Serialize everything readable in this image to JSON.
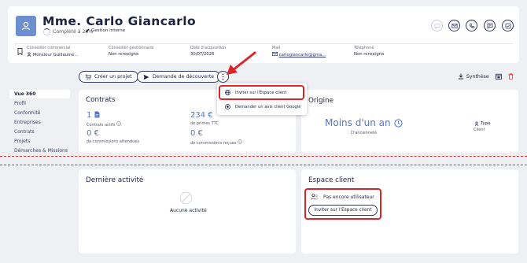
{
  "header": {
    "client_name": "Mme. Carlo Giancarlo",
    "completion": "Complété à 20%",
    "gestion_label": "Gestion interne",
    "fields": [
      {
        "label": "Conseiller commercial",
        "value": "Monsieur Guillaume..."
      },
      {
        "label": "Conseiller gestionnaire",
        "value": "Non renseigné"
      },
      {
        "label": "Date d'acquisition",
        "value": "30/07/2026"
      },
      {
        "label": "Mail",
        "value": "carlogiancarlo@gma..."
      },
      {
        "label": "Téléphone",
        "value": "Non renseigné"
      }
    ]
  },
  "sidebar": {
    "items": [
      {
        "label": "Vue 360"
      },
      {
        "label": "Profil"
      },
      {
        "label": "Conformité"
      },
      {
        "label": "Entreprises"
      },
      {
        "label": "Contrats"
      },
      {
        "label": "Projets"
      },
      {
        "label": "Démarches & Missions"
      }
    ]
  },
  "actions": {
    "create_project": "Créer un projet",
    "discovery_request": "Demande de découverte",
    "synthese": "Synthèse"
  },
  "menu": {
    "items": [
      {
        "label": "Inviter sur l'Espace client"
      },
      {
        "label": "Demander un avis client Google"
      }
    ]
  },
  "contrats": {
    "title": "Contrats",
    "active_count": "1",
    "active_label": "Contrats actifs",
    "primes_value": "234 €",
    "primes_label": "de primes TTC",
    "attendues_value": "0 €",
    "attendues_label": "de commissions attendues",
    "recues_value": "0 €",
    "recues_label": "de commissions reçues"
  },
  "origine": {
    "title": "Origine",
    "anciennete_value": "Moins d'un an",
    "anciennete_label": "D'ancienneté",
    "type_label": "Type",
    "type_value": "Client"
  },
  "activite": {
    "title": "Dernière activité",
    "empty": "Aucune activité"
  },
  "espace": {
    "title": "Espace client",
    "status": "Pas encore utilisateur",
    "invite_button": "Inviter sur l'Espace client"
  },
  "colors": {
    "accent": "#5575c4",
    "navy": "#1c2340",
    "annotation_red": "#d8262a",
    "background": "#eef0f4"
  }
}
